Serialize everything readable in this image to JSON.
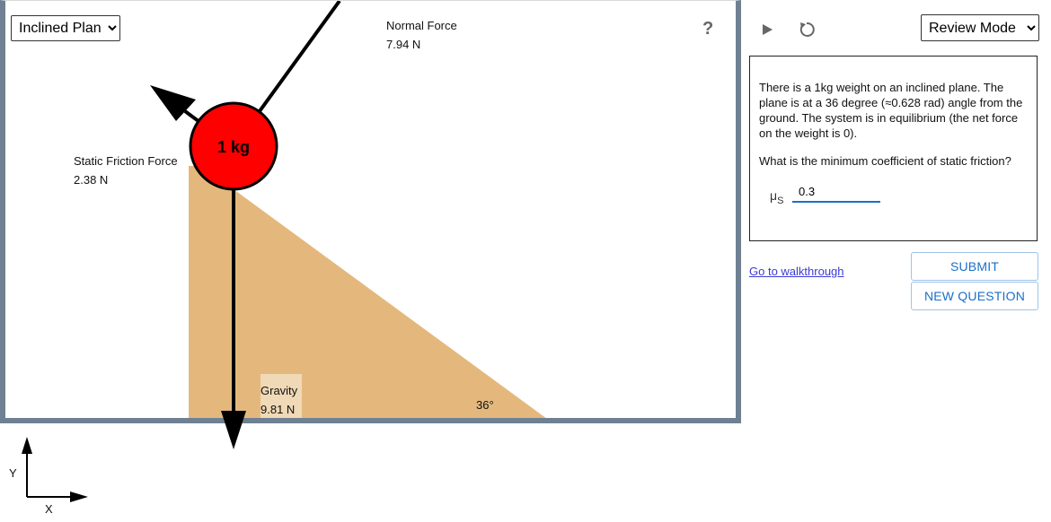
{
  "scene_select": {
    "selected": "Inclined Plane",
    "options": [
      "Inclined Plane"
    ]
  },
  "weight": {
    "label": "1 kg",
    "color": "#ff0000"
  },
  "forces": {
    "normal": {
      "name": "Normal Force",
      "value": "7.94 N"
    },
    "friction": {
      "name": "Static Friction Force",
      "value": "2.38 N"
    },
    "gravity": {
      "name": "Gravity",
      "value": "9.81 N"
    }
  },
  "incline": {
    "angle_label": "36°",
    "color": "#e4b87d"
  },
  "help": {
    "label": "?"
  },
  "axes": {
    "x_label": "X",
    "y_label": "Y"
  },
  "controls": {
    "play_icon": "play-icon",
    "reset_icon": "reset-icon"
  },
  "mode_select": {
    "selected": "Review Mode",
    "options": [
      "Review Mode"
    ]
  },
  "question": {
    "text": "There is a 1kg weight on an inclined plane. The plane is at a 36 degree (≈0.628 rad) angle from the ground. The system is in equilibrium (the net force on the weight is 0).",
    "prompt": "What is the minimum coefficient of static friction?",
    "answer_symbol": "μ",
    "answer_subscript": "S",
    "answer_value": "0.3"
  },
  "links": {
    "walkthrough": "Go to walkthrough"
  },
  "buttons": {
    "submit": "SUBMIT",
    "new_question": "NEW QUESTION"
  },
  "colors": {
    "frame": "#6f8092",
    "accent": "#1a6fc9",
    "link": "#3b3bd6"
  }
}
